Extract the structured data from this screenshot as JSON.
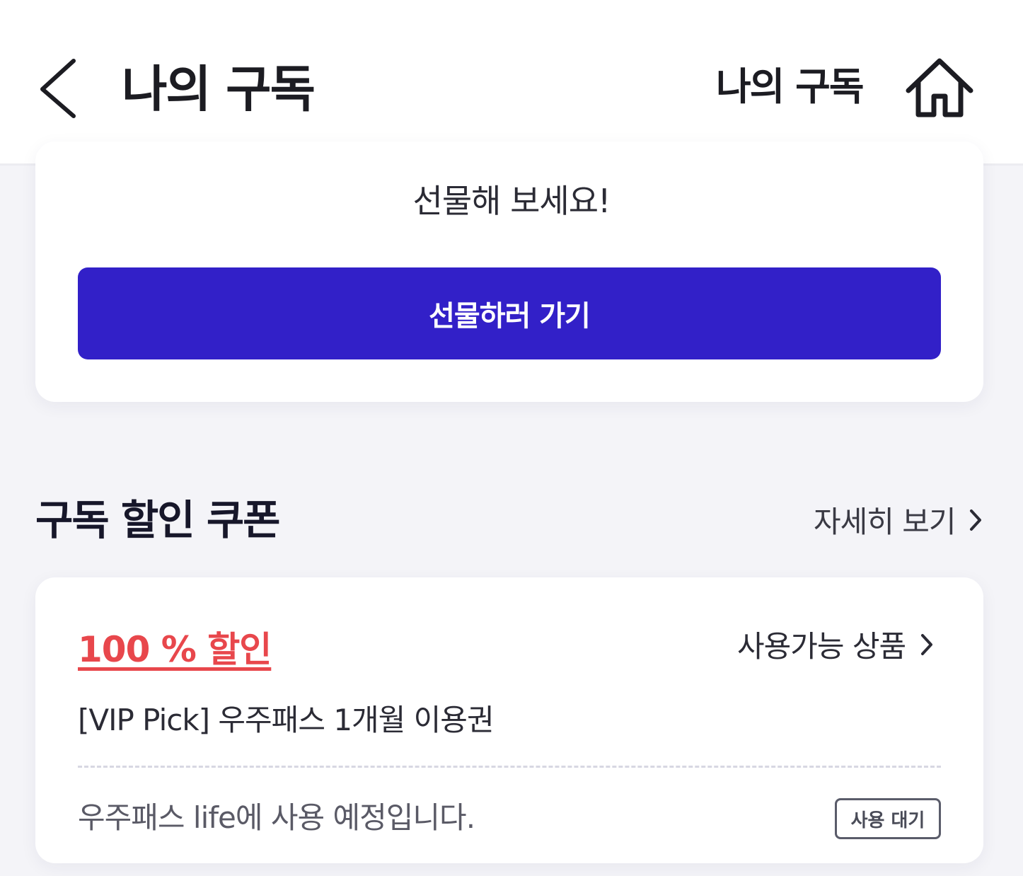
{
  "header": {
    "title": "나의 구독",
    "right_title": "나의 구독",
    "back_icon": "chevron-left-icon",
    "home_icon": "home-icon"
  },
  "gift": {
    "message": "선물해 보세요!",
    "button_label": "선물하러 가기",
    "button_color": "#3220c8"
  },
  "coupons_section": {
    "title": "구독 할인 쿠폰",
    "detail_link": "자세히 보기"
  },
  "coupon": {
    "discount": "100 % 할인",
    "discount_color": "#e8474c",
    "products_link": "사용가능 상품",
    "name": "[VIP Pick] 우주패스 1개월 이용권",
    "usage_note": "우주패스 life에 사용 예정입니다.",
    "status": "사용 대기"
  }
}
